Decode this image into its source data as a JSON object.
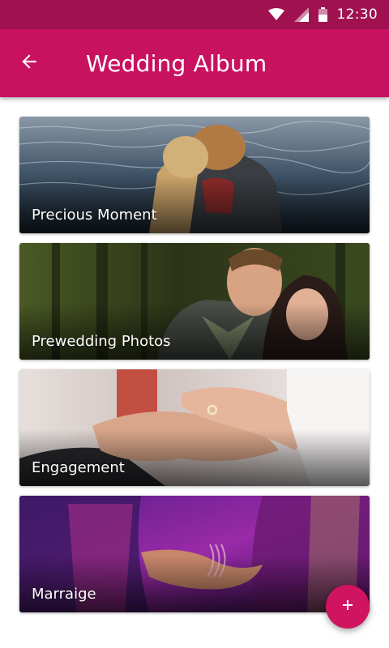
{
  "status_bar": {
    "time": "12:30",
    "icons": [
      "wifi-icon",
      "cellular-signal-icon",
      "battery-icon"
    ]
  },
  "app_bar": {
    "title": "Wedding Album",
    "back_icon": "arrow-back-icon",
    "color": "#c8125f",
    "status_color": "#a0124f"
  },
  "albums": [
    {
      "label": "Precious Moment",
      "image": "couple-by-the-sea"
    },
    {
      "label": "Prewedding Photos",
      "image": "couple-in-forest"
    },
    {
      "label": "Engagement",
      "image": "ring-exchange-hands"
    },
    {
      "label": "Marraige",
      "image": "bride-groom-holding-hands"
    }
  ],
  "fab": {
    "icon": "add-icon",
    "color": "#d0145f"
  }
}
